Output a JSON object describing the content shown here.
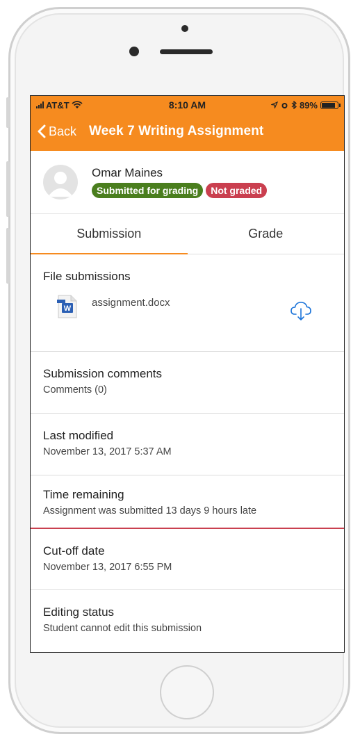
{
  "status_bar": {
    "carrier": "AT&T",
    "time": "8:10 AM",
    "battery": "89%",
    "battery_level": 0.89
  },
  "nav": {
    "back_label": "Back",
    "title": "Week 7 Writing Assignment"
  },
  "user": {
    "name": "Omar Maines",
    "badges": [
      {
        "label": "Submitted for grading",
        "color": "#4a7e1e"
      },
      {
        "label": "Not graded",
        "color": "#ca3f4f"
      }
    ]
  },
  "tabs": [
    {
      "label": "Submission",
      "active": true
    },
    {
      "label": "Grade",
      "active": false
    }
  ],
  "file_submissions": {
    "title": "File submissions",
    "files": [
      {
        "name": "assignment.docx",
        "icon": "word-document-icon",
        "action_icon": "cloud-download-icon"
      }
    ]
  },
  "comments": {
    "title": "Submission comments",
    "value": "Comments (0)"
  },
  "last_modified": {
    "title": "Last modified",
    "value": "November 13, 2017 5:37 AM"
  },
  "time_remaining": {
    "title": "Time remaining",
    "value": "Assignment was submitted 13 days 9 hours late"
  },
  "cutoff": {
    "title": "Cut-off date",
    "value": "November 13, 2017 6:55 PM"
  },
  "editing": {
    "title": "Editing status",
    "value": "Student cannot edit this submission"
  },
  "colors": {
    "accent": "#f68b1f",
    "success": "#4a7e1e",
    "danger": "#ca3f4f",
    "link": "#1a73d9"
  }
}
